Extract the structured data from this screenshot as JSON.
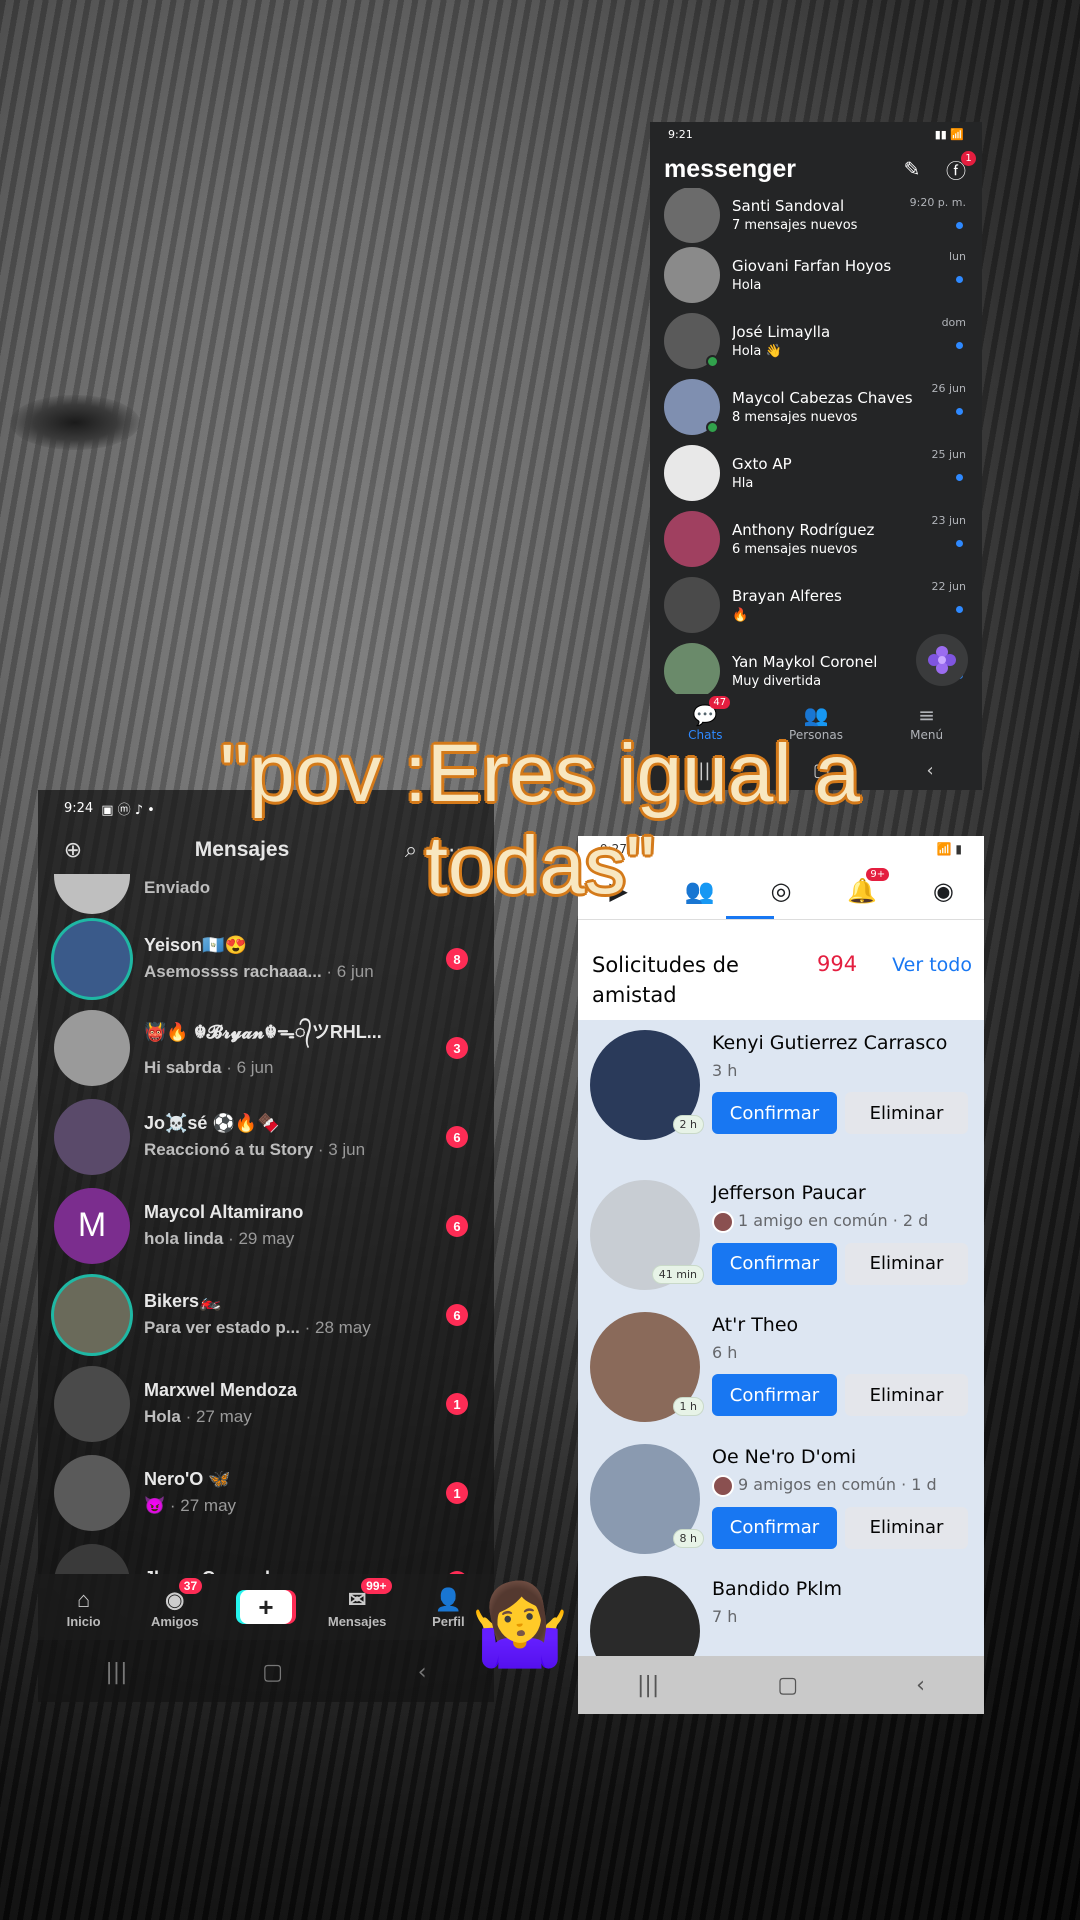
{
  "caption": "\"pov :Eres igual a todas\"",
  "emoji": "🤷‍♀️",
  "messenger": {
    "status_time": "9:21",
    "brand": "messenger",
    "header_badge": "1",
    "chats": [
      {
        "name": "Santi Sandoval",
        "preview": "7 mensajes nuevos",
        "time": "9:20 p. m.",
        "avatar": "#6b6b6b",
        "online": false
      },
      {
        "name": "Giovani Farfan Hoyos",
        "preview": "Hola",
        "time": "lun",
        "avatar": "#8a8a8a",
        "online": false
      },
      {
        "name": "José Limaylla",
        "preview": "Hola 👋",
        "time": "dom",
        "avatar": "#5a5a5a",
        "online": true
      },
      {
        "name": "Maycol Cabezas Chaves",
        "preview": "8 mensajes nuevos",
        "time": "26 jun",
        "avatar": "#7f8fb0",
        "online": true
      },
      {
        "name": "Gxto AP",
        "preview": "Hla",
        "time": "25 jun",
        "avatar": "#e8e8e8",
        "online": false
      },
      {
        "name": "Anthony Rodríguez",
        "preview": "6 mensajes nuevos",
        "time": "23 jun",
        "avatar": "#a04060",
        "online": false
      },
      {
        "name": "Brayan Alferes",
        "preview": "🔥",
        "time": "22 jun",
        "avatar": "#4a4a4a",
        "online": false
      },
      {
        "name": "Yan Maykol Coronel",
        "preview": "Muy divertida",
        "time": "",
        "avatar": "#6a8a6a",
        "online": false
      }
    ],
    "tabs": [
      {
        "label": "Chats",
        "badge": "47"
      },
      {
        "label": "Personas",
        "badge": ""
      },
      {
        "label": "Menú",
        "badge": ""
      }
    ]
  },
  "tiktok": {
    "status_time": "9:24",
    "title": "Mensajes",
    "first_row_preview": "Enviado",
    "chats": [
      {
        "name": "Yeison🇬🇹😍",
        "preview": "Asemossss rachaaa...",
        "when": " · 6 jun",
        "count": "8",
        "avatar": "#3a5a8a",
        "ring": true,
        "letter": ""
      },
      {
        "name": "👹🔥 ☬𝓑𝓻𝔂𝓪𝓷☬ᯓ᭄ツRHL...",
        "preview": "Hi sabrda",
        "when": " · 6 jun",
        "count": "3",
        "avatar": "#9a9a9a",
        "ring": false,
        "letter": ""
      },
      {
        "name": "Jo☠️sé ⚽🔥🍫",
        "preview": "Reaccionó a tu Story",
        "when": " · 3 jun",
        "count": "6",
        "avatar": "#5a4a6a",
        "ring": false,
        "letter": ""
      },
      {
        "name": "Maycol Altamirano",
        "preview": "hola linda",
        "when": " · 29 may",
        "count": "6",
        "avatar": "#7b2d8e",
        "ring": false,
        "letter": "M"
      },
      {
        "name": "Bikers🏍️",
        "preview": "Para ver estado p...",
        "when": " · 28 may",
        "count": "6",
        "avatar": "#6a6a5a",
        "ring": true,
        "letter": ""
      },
      {
        "name": "Marxwel Mendoza",
        "preview": "Hola",
        "when": " · 27 may",
        "count": "1",
        "avatar": "#4a4a4a",
        "ring": false,
        "letter": ""
      },
      {
        "name": "Nero'O 🦋",
        "preview": "😈",
        "when": " · 27 may",
        "count": "1",
        "avatar": "#5a5a5a",
        "ring": false,
        "letter": ""
      },
      {
        "name": "Jhony Coronel",
        "preview": "",
        "when": "",
        "count": "1",
        "avatar": "#3a3a3a",
        "ring": false,
        "letter": ""
      }
    ],
    "bottom_tabs": [
      {
        "label": "Inicio",
        "badge": ""
      },
      {
        "label": "Amigos",
        "badge": "37"
      },
      {
        "label": "",
        "badge": ""
      },
      {
        "label": "Mensajes",
        "badge": "99+"
      },
      {
        "label": "Perfil",
        "badge": ""
      }
    ]
  },
  "facebook": {
    "status_time": "9:27",
    "notif_badge": "9+",
    "section_title": "Solicitudes de amistad",
    "count": "994",
    "see_all": "Ver todo",
    "confirm_label": "Confirmar",
    "delete_label": "Eliminar",
    "requests": [
      {
        "name": "Kenyi Gutierrez Carrasco",
        "meta": "3 h",
        "age": "2 h",
        "avatar": "#2a3a5a",
        "mutual": false
      },
      {
        "name": "Jefferson Paucar",
        "meta": "1 amigo en común · 2 d",
        "age": "41 min",
        "avatar": "#c8cdd3",
        "mutual": true
      },
      {
        "name": "At'r Theo",
        "meta": "6 h",
        "age": "1 h",
        "avatar": "#8a6a5a",
        "mutual": false
      },
      {
        "name": "Oe Ne'ro D'omi",
        "meta": "9 amigos en común · 1 d",
        "age": "8 h",
        "avatar": "#8a9ab0",
        "mutual": true
      },
      {
        "name": "Bandido Pklm",
        "meta": "7 h",
        "age": "",
        "avatar": "#2a2a2a",
        "mutual": false
      }
    ]
  }
}
